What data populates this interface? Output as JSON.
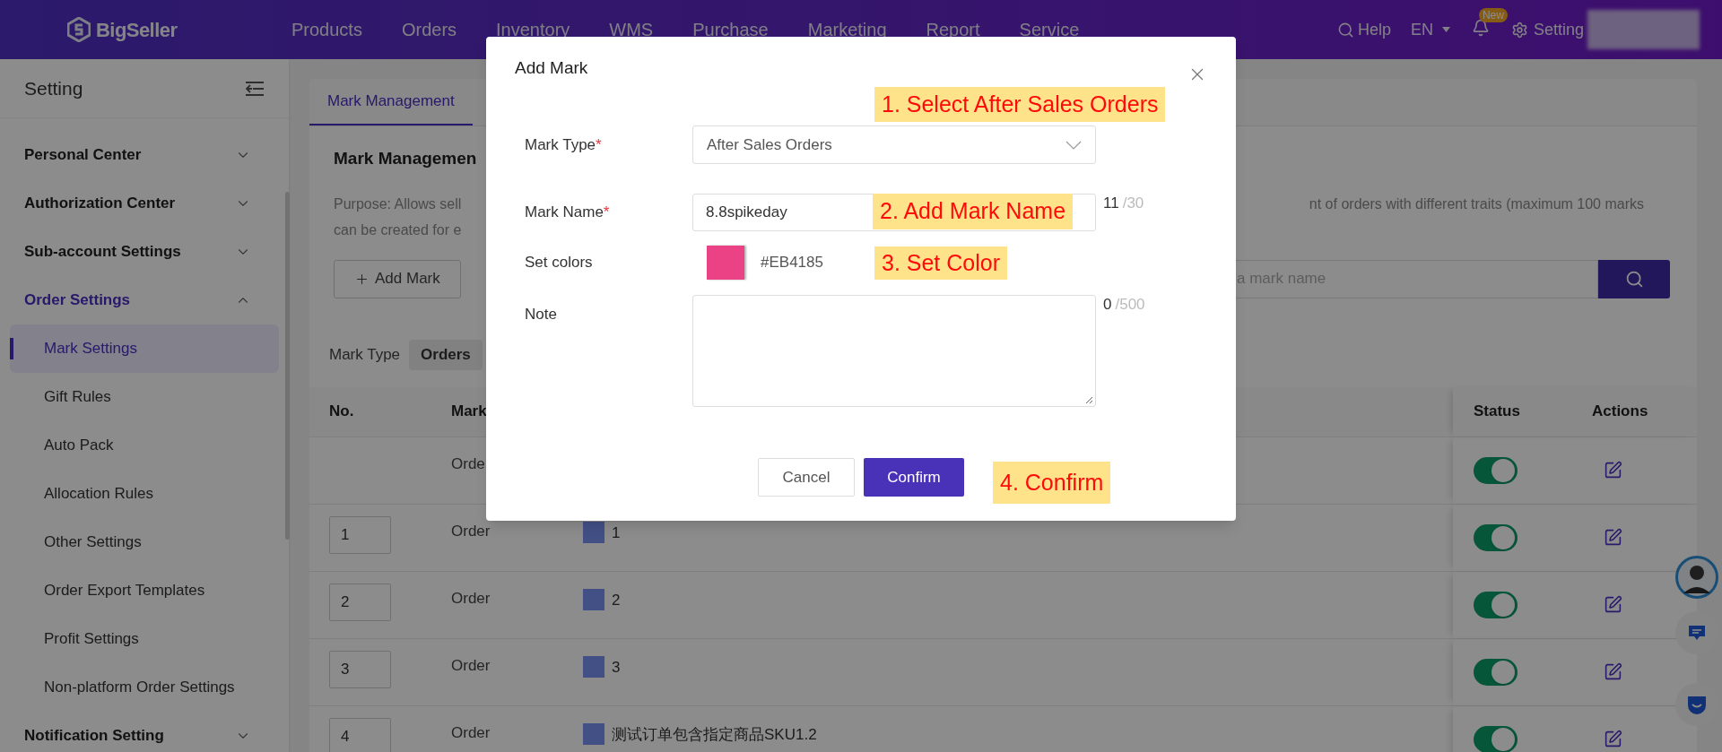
{
  "top_nav": {
    "logo": "BigSeller",
    "menu": [
      "Products",
      "Orders",
      "Inventory",
      "WMS",
      "Purchase",
      "Marketing",
      "Report",
      "Service"
    ],
    "help": "Help",
    "language": "EN",
    "badge": "New",
    "settings": "Setting"
  },
  "sidebar": {
    "title": "Setting",
    "groups": [
      {
        "label": "Personal Center",
        "expanded": false,
        "selected": false
      },
      {
        "label": "Authorization Center",
        "expanded": false,
        "selected": false
      },
      {
        "label": "Sub-account Settings",
        "expanded": false,
        "selected": false
      },
      {
        "label": "Order Settings",
        "expanded": true,
        "selected": true,
        "children": [
          {
            "label": "Mark Settings",
            "selected": true
          },
          {
            "label": "Gift Rules",
            "selected": false
          },
          {
            "label": "Auto Pack",
            "selected": false
          },
          {
            "label": "Allocation Rules",
            "selected": false
          },
          {
            "label": "Other Settings",
            "selected": false
          },
          {
            "label": "Order Export Templates",
            "selected": false
          },
          {
            "label": "Profit Settings",
            "selected": false
          },
          {
            "label": "Non-platform Order Settings",
            "selected": false
          }
        ]
      },
      {
        "label": "Notification Setting",
        "expanded": false,
        "selected": false
      }
    ]
  },
  "main": {
    "tabs": [
      {
        "label": "Mark Management",
        "selected": true
      }
    ],
    "heading": "Mark Managemen",
    "purpose": {
      "left_lines": [
        "Purpose: Allows sell",
        "can be created for e"
      ],
      "right_line": "nt of orders with different traits (maximum 100 marks"
    },
    "add_button": "Add Mark",
    "search_placeholder": "a mark name",
    "filter": {
      "label": "Mark Type",
      "value": "Orders"
    },
    "table": {
      "columns": [
        "No.",
        "Mark",
        "Status",
        "Actions"
      ],
      "rows": [
        {
          "type": "Orde",
          "on": true
        },
        {
          "no": "1",
          "type": "Order",
          "mark": "1",
          "on": true
        },
        {
          "no": "2",
          "type": "Order",
          "mark": "2",
          "on": true
        },
        {
          "no": "3",
          "type": "Order",
          "mark": "3",
          "on": true
        },
        {
          "no": "4",
          "type": "Order",
          "mark": "测试订单包含指定商品SKU1.2",
          "on": true
        }
      ]
    }
  },
  "modal": {
    "title": "Add Mark",
    "fields": [
      {
        "kind": "select",
        "label": "Mark Type",
        "required_mark": "*",
        "value": "After Sales Orders"
      },
      {
        "kind": "text",
        "label": "Mark Name",
        "required_mark": "*",
        "value": "8.8spikeday",
        "count": "11",
        "limit": "/30"
      },
      {
        "kind": "color",
        "label": "Set colors",
        "value": "#EB4185"
      },
      {
        "kind": "textarea",
        "label": "Note",
        "count": "0",
        "limit": "/500"
      }
    ],
    "buttons": [
      {
        "kind": "secondary",
        "label": "Cancel"
      },
      {
        "kind": "primary",
        "label": "Confirm"
      }
    ]
  },
  "annotations": [
    {
      "text": "1. Select After Sales Orders"
    },
    {
      "text": "2. Add Mark Name"
    },
    {
      "text": "3. Set Color"
    },
    {
      "text": "4. Confirm"
    }
  ]
}
